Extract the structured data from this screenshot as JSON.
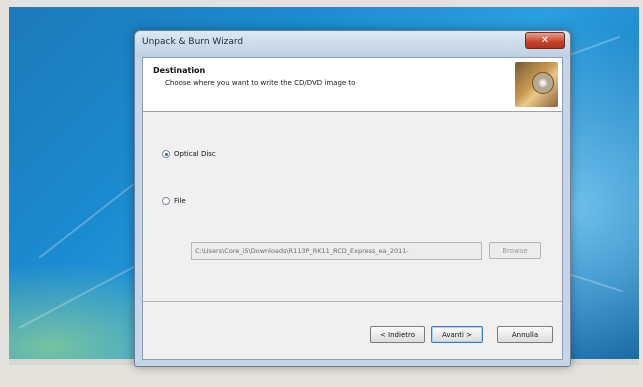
{
  "window": {
    "title": "Unpack & Burn Wizard",
    "close_glyph": "✕"
  },
  "header": {
    "title": "Destination",
    "subtitle": "Choose where you want to write the CD/DVD image to",
    "icon": "disc-burn-icon"
  },
  "options": {
    "optical_disc_label": "Optical Disc",
    "optical_disc_selected": true,
    "file_label": "File",
    "file_selected": false,
    "file_path_value": "C:\\Users\\Core_i5\\Downloads\\R113P_RK11_RCD_Express_ea_2011-",
    "browse_label": "Browse"
  },
  "footer": {
    "back_label": "< Indietro",
    "next_label": "Avanti >",
    "cancel_label": "Annulla"
  },
  "colors": {
    "desktop_blue": "#1b8bd0",
    "close_red": "#c8452d",
    "window_frame": "#c6d6e6"
  }
}
